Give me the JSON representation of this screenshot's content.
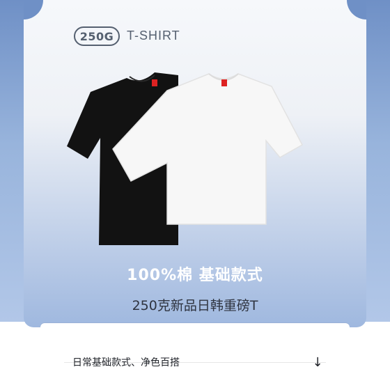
{
  "header": {
    "weight_badge": "250G",
    "product_type": "T-SHIRT"
  },
  "product": {
    "headline": "100%棉 基础款式",
    "subline": "250克新品日韩重磅T",
    "colors": [
      "#121212",
      "#f5f5f5"
    ]
  },
  "info": {
    "text": "日常基础款式、净色百搭",
    "toggle_icon": "arrow-down-icon",
    "toggle_glyph": "↓"
  }
}
